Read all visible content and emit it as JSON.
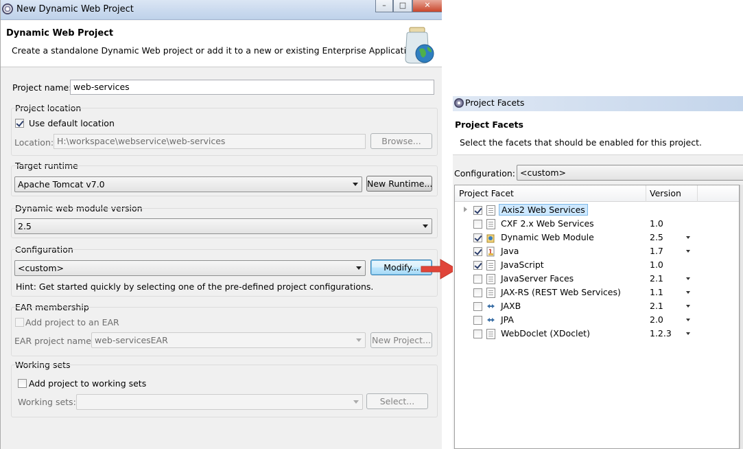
{
  "main_window": {
    "title": "New Dynamic Web Project",
    "header_title": "Dynamic Web Project",
    "header_description": "Create a standalone Dynamic Web project or add it to a new or existing Enterprise Application.",
    "project_name_label": "Project name:",
    "project_name_value": "web-services",
    "project_location": {
      "group_label": "Project location",
      "use_default_label": "Use default location",
      "use_default_checked": true,
      "location_label": "Location:",
      "location_value": "H:\\workspace\\webservice\\web-services",
      "browse_label": "Browse..."
    },
    "target_runtime": {
      "group_label": "Target runtime",
      "selected": "Apache Tomcat v7.0",
      "new_runtime_label": "New Runtime..."
    },
    "web_module_version": {
      "group_label": "Dynamic web module version",
      "selected": "2.5"
    },
    "configuration": {
      "group_label": "Configuration",
      "selected": "<custom>",
      "modify_label": "Modify...",
      "hint": "Hint: Get started quickly by selecting one of the pre-defined project configurations."
    },
    "ear_membership": {
      "group_label": "EAR membership",
      "add_label": "Add project to an EAR",
      "ear_name_label": "EAR project name:",
      "ear_name_value": "web-servicesEAR",
      "new_project_label": "New Project..."
    },
    "working_sets": {
      "group_label": "Working sets",
      "add_label": "Add project to working sets",
      "sets_label": "Working sets:",
      "select_label": "Select..."
    }
  },
  "facets_window": {
    "title": "Project Facets",
    "header_title": "Project Facets",
    "header_description": "Select the facets that should be enabled for this project.",
    "configuration_label": "Configuration:",
    "configuration_value": "<custom>",
    "columns": {
      "facet": "Project Facet",
      "version": "Version"
    },
    "facets": [
      {
        "name": "Axis2 Web Services",
        "version": "",
        "checked": true,
        "expandable": true,
        "dropdown": false,
        "icon": "document-icon"
      },
      {
        "name": "CXF 2.x Web Services",
        "version": "1.0",
        "checked": false,
        "expandable": false,
        "dropdown": false,
        "icon": "document-icon"
      },
      {
        "name": "Dynamic Web Module",
        "version": "2.5",
        "checked": true,
        "expandable": false,
        "dropdown": true,
        "icon": "web-module-icon"
      },
      {
        "name": "Java",
        "version": "1.7",
        "checked": true,
        "expandable": false,
        "dropdown": true,
        "icon": "java-icon"
      },
      {
        "name": "JavaScript",
        "version": "1.0",
        "checked": true,
        "expandable": false,
        "dropdown": false,
        "icon": "document-icon"
      },
      {
        "name": "JavaServer Faces",
        "version": "2.1",
        "checked": false,
        "expandable": false,
        "dropdown": true,
        "icon": "document-icon"
      },
      {
        "name": "JAX-RS (REST Web Services)",
        "version": "1.1",
        "checked": false,
        "expandable": false,
        "dropdown": true,
        "icon": "document-icon"
      },
      {
        "name": "JAXB",
        "version": "2.1",
        "checked": false,
        "expandable": false,
        "dropdown": true,
        "icon": "arrows-icon"
      },
      {
        "name": "JPA",
        "version": "2.0",
        "checked": false,
        "expandable": false,
        "dropdown": true,
        "icon": "arrows-icon"
      },
      {
        "name": "WebDoclet (XDoclet)",
        "version": "1.2.3",
        "checked": false,
        "expandable": false,
        "dropdown": true,
        "icon": "document-icon"
      }
    ]
  },
  "colors": {
    "arrow": "#e0453a",
    "selection": "#cde8ff"
  }
}
